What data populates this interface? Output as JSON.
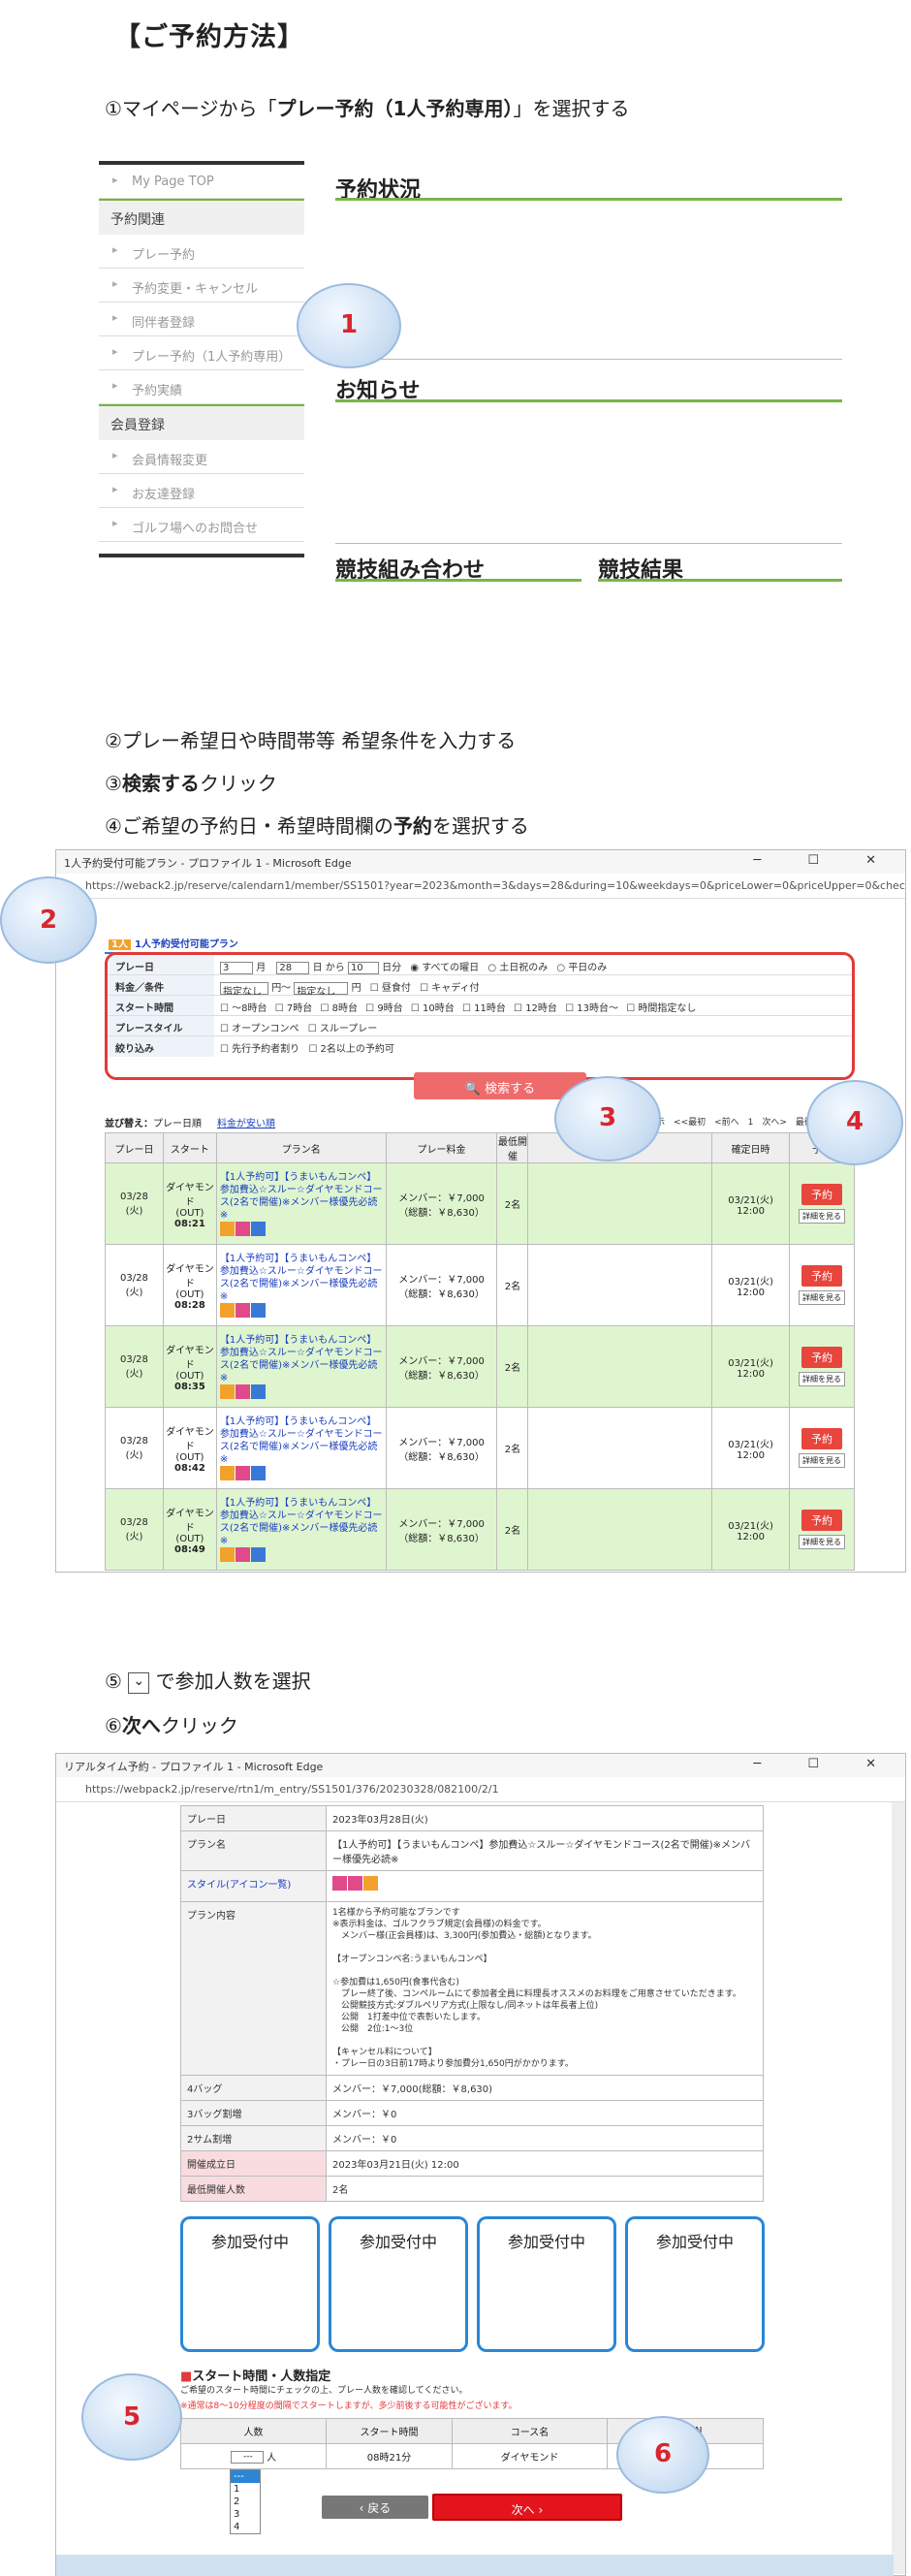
{
  "header": "【ご予約方法】",
  "steps": {
    "s1_prefix": "①マイページから「",
    "s1_bold": "プレー予約（1人予約専用）",
    "s1_suffix": "」を選択する",
    "s2": "②プレー希望日や時間帯等 希望条件を入力する",
    "s3_prefix": "③",
    "s3_bold": "検索する",
    "s3_suffix": "クリック",
    "s4_prefix": "④ご希望の予約日・希望時間欄の",
    "s4_bold": "予約",
    "s4_suffix": "を選択する",
    "s5_prefix": "⑤",
    "s5_icon": "⌄",
    "s5_suffix": "で参加人数を選択",
    "s6_prefix": "⑥",
    "s6_bold": "次へ",
    "s6_suffix": "クリック"
  },
  "mypage": {
    "menu": {
      "top": "My Page TOP",
      "section1": "予約関連",
      "items1": [
        "プレー予約",
        "予約変更・キャンセル",
        "同伴者登録",
        "プレー予約（1人予約専用）",
        "予約実績"
      ],
      "section2": "会員登録",
      "items2": [
        "会員情報変更",
        "お友達登録",
        "ゴルフ場へのお問合せ"
      ]
    },
    "reservation_status": "予約状況",
    "notice": "お知らせ",
    "competition_pairing": "競技組み合わせ",
    "competition_result": "競技結果"
  },
  "callouts": [
    "1",
    "2",
    "3",
    "4",
    "5",
    "6"
  ],
  "window2": {
    "title": "1人予約受付可能プラン - プロファイル 1 - Microsoft Edge",
    "url": "https://weback2.jp/reserve/calendarn1/member/SS1501?year=2023&month=3&days=28&during=10&weekdays=0&priceLower=0&priceUpper=0&chec...",
    "badge": "1人予約受付可能プラン",
    "form": {
      "play_date_label": "プレー日",
      "month_value": "3",
      "month_unit": "月",
      "day_value": "28",
      "day_unit": "日 から",
      "during_value": "10",
      "during_unit": "日分",
      "day_options": [
        "すべての曜日",
        "土日祝のみ",
        "平日のみ"
      ],
      "price_label": "料金／条件",
      "price_min": "指定なし",
      "price_sep": "円～",
      "price_max": "指定なし",
      "price_unit": "円",
      "price_options": [
        "昼食付",
        "キャディ付"
      ],
      "time_label": "スタート時間",
      "time_options": [
        "～8時台",
        "7時台",
        "8時台",
        "9時台",
        "10時台",
        "11時台",
        "12時台",
        "13時台～",
        "時間指定なし"
      ],
      "style_label": "プレースタイル",
      "style_options": [
        "オープンコンペ",
        "スループレー"
      ],
      "filter_label": "絞り込み",
      "filter_options": [
        "先行予約者割り",
        "2名以上の予約可"
      ]
    },
    "search_button": "検索する",
    "sort_label": "並び替え：",
    "sort_options": [
      "プレー日順",
      "料金が安い順"
    ],
    "pager": "5件中 1～5件表示　<<最初　<前へ　1　次へ>　最後>>",
    "table_headers": [
      "プレー日",
      "スタート",
      "プラン名",
      "プレー料金",
      "最低開催",
      "予約状況",
      "確定日時",
      "予約"
    ],
    "rows": [
      {
        "date": "03/28",
        "dow": "(火)",
        "course": "ダイヤモンド",
        "inout": "(OUT)",
        "time": "08:21",
        "plan": "【1人予約可】【うまいもんコンペ】参加費込☆スルー☆ダイヤモンドコース(2名で開催)※メンバー様優先必読※",
        "fee1": "メンバー：￥7,000",
        "fee2": "（総額：￥8,630）",
        "min": "2名",
        "fixed1": "03/21(火)",
        "fixed2": "12:00",
        "btn": "予約",
        "detail": "詳細を見る"
      },
      {
        "date": "03/28",
        "dow": "(火)",
        "course": "ダイヤモンド",
        "inout": "(OUT)",
        "time": "08:28",
        "plan": "【1人予約可】【うまいもんコンペ】参加費込☆スルー☆ダイヤモンドコース(2名で開催)※メンバー様優先必読※",
        "fee1": "メンバー：￥7,000",
        "fee2": "（総額：￥8,630）",
        "min": "2名",
        "fixed1": "03/21(火)",
        "fixed2": "12:00",
        "btn": "予約",
        "detail": "詳細を見る"
      },
      {
        "date": "03/28",
        "dow": "(火)",
        "course": "ダイヤモンド",
        "inout": "(OUT)",
        "time": "08:35",
        "plan": "【1人予約可】【うまいもんコンペ】参加費込☆スルー☆ダイヤモンドコース(2名で開催)※メンバー様優先必読※",
        "fee1": "メンバー：￥7,000",
        "fee2": "（総額：￥8,630）",
        "min": "2名",
        "fixed1": "03/21(火)",
        "fixed2": "12:00",
        "btn": "予約",
        "detail": "詳細を見る"
      },
      {
        "date": "03/28",
        "dow": "(火)",
        "course": "ダイヤモンド",
        "inout": "(OUT)",
        "time": "08:42",
        "plan": "【1人予約可】【うまいもんコンペ】参加費込☆スルー☆ダイヤモンドコース(2名で開催)※メンバー様優先必読※",
        "fee1": "メンバー：￥7,000",
        "fee2": "（総額：￥8,630）",
        "min": "2名",
        "fixed1": "03/21(火)",
        "fixed2": "12:00",
        "btn": "予約",
        "detail": "詳細を見る"
      },
      {
        "date": "03/28",
        "dow": "(火)",
        "course": "ダイヤモンド",
        "inout": "(OUT)",
        "time": "08:49",
        "plan": "【1人予約可】【うまいもんコンペ】参加費込☆スルー☆ダイヤモンドコース(2名で開催)※メンバー様優先必読※",
        "fee1": "メンバー：￥7,000",
        "fee2": "（総額：￥8,630）",
        "min": "2名",
        "fixed1": "03/21(火)",
        "fixed2": "12:00",
        "btn": "予約",
        "detail": "詳細を見る"
      }
    ]
  },
  "window3": {
    "title": "リアルタイム予約 - プロファイル 1 - Microsoft Edge",
    "url": "https://webpack2.jp/reserve/rtn1/m_entry/SS1501/376/20230328/082100/2/1",
    "details": [
      {
        "k": "プレー日",
        "v": "2023年03月28日(火)"
      },
      {
        "k": "プラン名",
        "v": "【1人予約可】【うまいもんコンペ】参加費込☆スルー☆ダイヤモンドコース(2名で開催)※メンバー様優先必読※"
      },
      {
        "k": "スタイル(アイコン一覧)",
        "v": ""
      },
      {
        "k": "プラン内容",
        "v": "1名様から予約可能なプランです\n※表示料金は、ゴルフクラブ規定(会員様)の料金です。\n　メンバー様(正会員様)は、3,300円(参加費込・総額)となります。\n\n【オープンコンペ名:うまいもんコンペ】\n\n☆参加費は1,650円(食事代含む)\n　プレー終了後、コンペルームにて参加者全員に料理長オススメのお料理をご用意させていただきます。\n　公開競技方式:ダブルペリア方式(上限なし/同ネットは年長者上位)\n　公開　1打差中位で表彰いたします。\n　公開　2位:1～3位\n\n【キャンセル料について】\n・プレー日の3日前17時より参加費分1,650円がかかります。"
      },
      {
        "k": "4バッグ",
        "v": "メンバー：￥7,000(総額：￥8,630)"
      },
      {
        "k": "3バッグ割増",
        "v": "メンバー：￥0"
      },
      {
        "k": "2サム割増",
        "v": "メンバー：￥0"
      },
      {
        "k": "開催成立日",
        "v": "2023年03月21日(火) 12:00"
      },
      {
        "k": "最低開催人数",
        "v": "2名"
      }
    ],
    "cards": [
      "参加受付中",
      "参加受付中",
      "参加受付中",
      "参加受付中"
    ],
    "section_title": "スタート時間・人数指定",
    "section_note": "ご希望のスタート時間にチェックの上、プレー人数を確認してください。",
    "section_warn": "※通常は8～10分程度の間隔でスタートしますが、多少前後する可能性がございます。",
    "table_headers": [
      "人数",
      "スタート時間",
      "コース名",
      "OUT/IN"
    ],
    "row": {
      "select": "---",
      "unit": "人",
      "time": "08時21分",
      "course": "ダイヤモンド",
      "inout": "OUT"
    },
    "dropdown_options": [
      "---",
      "1",
      "2",
      "3",
      "4"
    ],
    "back_button": "戻る",
    "next_button": "次へ"
  },
  "colors": {
    "accent_red": "#e23a3a",
    "green_row": "#dff5cf",
    "blue_card": "#2b86d6",
    "green_line": "#7ab547"
  }
}
